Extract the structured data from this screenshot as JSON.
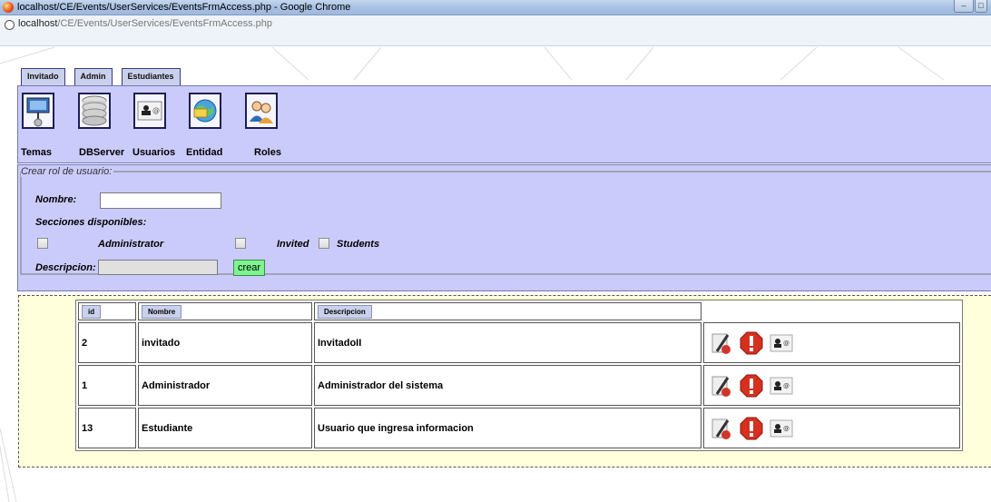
{
  "window": {
    "title": "localhost/CE/Events/UserServices/EventsFrmAccess.php - Google Chrome"
  },
  "address": {
    "host": "localhost",
    "path": "/CE/Events/UserServices/EventsFrmAccess.php"
  },
  "tabs": [
    {
      "label": "Invitado"
    },
    {
      "label": "Admin"
    },
    {
      "label": "Estudiantes"
    }
  ],
  "toolbar": {
    "items": [
      {
        "label": "Temas",
        "icon": "presentation-board-icon"
      },
      {
        "label": "DBServer",
        "icon": "database-icon"
      },
      {
        "label": "Usuarios",
        "icon": "contact-card-icon"
      },
      {
        "label": "Entidad",
        "icon": "globe-entity-icon"
      },
      {
        "label": "Roles",
        "icon": "people-roles-icon"
      }
    ]
  },
  "form": {
    "legend": "Crear rol de usuario:",
    "nombre_label": "Nombre:",
    "nombre_value": "",
    "secciones_label": "Secciones disponibles:",
    "sections": [
      {
        "label": "Administrator",
        "checked": false
      },
      {
        "label": "Invited",
        "checked": false
      },
      {
        "label": "Students",
        "checked": false
      }
    ],
    "descripcion_label": "Descripcion:",
    "descripcion_value": "",
    "submit_label": "crear"
  },
  "table": {
    "headers": [
      "id",
      "Nombre",
      "Descripcion"
    ],
    "rows": [
      {
        "id": "2",
        "nombre": "invitado",
        "descripcion": "InvitadoII"
      },
      {
        "id": "1",
        "nombre": "Administrador",
        "descripcion": "Administrador del sistema"
      },
      {
        "id": "13",
        "nombre": "Estudiante",
        "descripcion": "Usuario que ingresa informacion"
      }
    ],
    "row_actions": [
      "edit-icon",
      "delete-icon",
      "user-card-icon"
    ]
  },
  "colors": {
    "panel_bg": "#cbcbfb",
    "table_area_bg": "#ffffdb",
    "submit_bg": "#7cf48f",
    "tab_bg": "#c9d1ec"
  }
}
